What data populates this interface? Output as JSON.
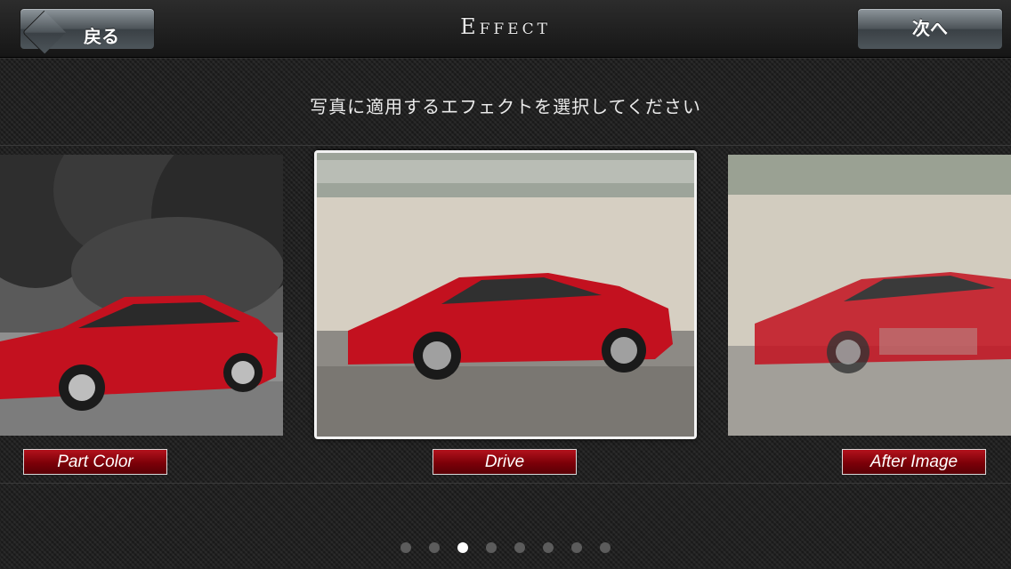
{
  "header": {
    "title": "Effect",
    "back_label": "戻る",
    "next_label": "次へ"
  },
  "instruction": "写真に適用するエフェクトを選択してください",
  "effects": [
    {
      "label": "Part Color"
    },
    {
      "label": "Drive"
    },
    {
      "label": "After Image"
    }
  ],
  "pager": {
    "count": 8,
    "current_page": 3
  },
  "colors": {
    "car_red": "#c3111f",
    "label_red": "#8a0710",
    "active_dot": "#ffffff",
    "inactive_dot": "#5c5c5c"
  }
}
